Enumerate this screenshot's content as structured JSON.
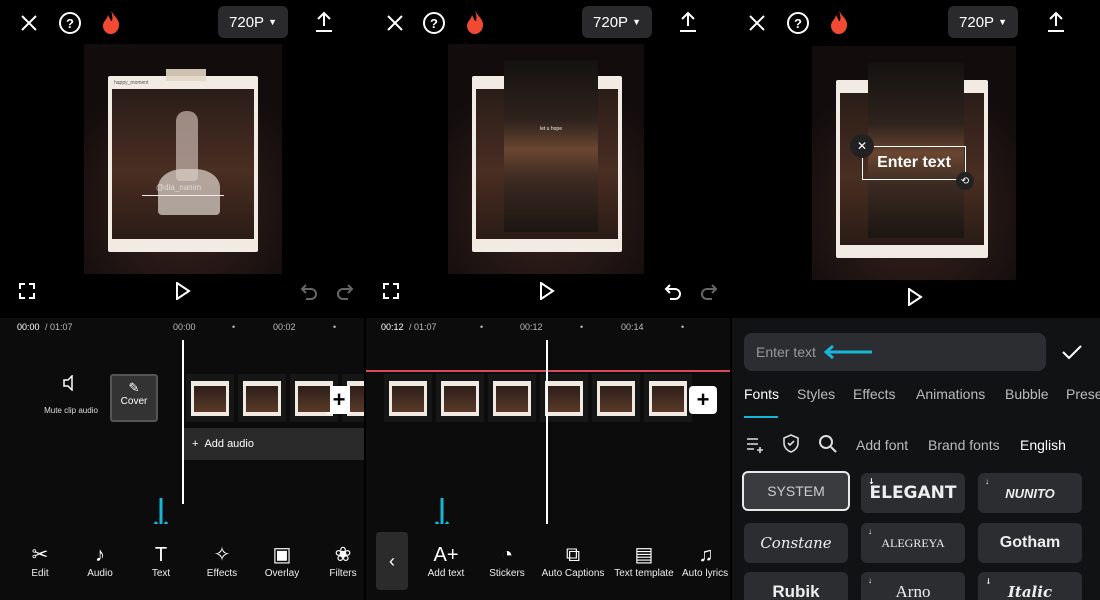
{
  "resolution": "720P",
  "panel1": {
    "time_current": "00:00",
    "time_total": "/ 01:07",
    "ticks": [
      "00:00",
      "00:02"
    ],
    "mute_label": "Mute clip audio",
    "cover_label": "Cover",
    "add_audio_label": "Add audio",
    "card_user": "happy_moment",
    "card_overlay": "@dia_nanim",
    "tools": [
      {
        "label": "Edit",
        "icon": "scissors-icon"
      },
      {
        "label": "Audio",
        "icon": "music-note-icon"
      },
      {
        "label": "Text",
        "icon": "text-t-icon"
      },
      {
        "label": "Effects",
        "icon": "sparkle-icon"
      },
      {
        "label": "Overlay",
        "icon": "overlay-icon"
      },
      {
        "label": "Filters",
        "icon": "filters-icon"
      }
    ]
  },
  "panel2": {
    "time_current": "00:12",
    "time_total": "/ 01:07",
    "ticks": [
      "00:12",
      "00:14"
    ],
    "overlay_small_text": "let u hope",
    "tools": [
      {
        "label": "Add text",
        "icon": "add-text-icon"
      },
      {
        "label": "Stickers",
        "icon": "sticker-icon"
      },
      {
        "label": "Auto Captions",
        "icon": "captions-icon"
      },
      {
        "label": "Text template",
        "icon": "text-template-icon"
      },
      {
        "label": "Auto lyrics",
        "icon": "lyrics-icon"
      }
    ]
  },
  "panel3": {
    "preview_text": "Enter text",
    "input_placeholder": "Enter text",
    "tabs": [
      "Fonts",
      "Styles",
      "Effects",
      "Animations",
      "Bubble",
      "Prese"
    ],
    "filters": [
      "Add font",
      "Brand fonts",
      "English"
    ],
    "fonts": [
      "SYSTEM",
      "ELEGANT",
      "NUNITO",
      "Constane",
      "ALEGREYA",
      "Gotham",
      "Rubik",
      "Arno",
      "Italic"
    ]
  },
  "colors": {
    "accent": "#16b7d6",
    "flame": "#f04a32",
    "dark": "#0c0c0c"
  }
}
